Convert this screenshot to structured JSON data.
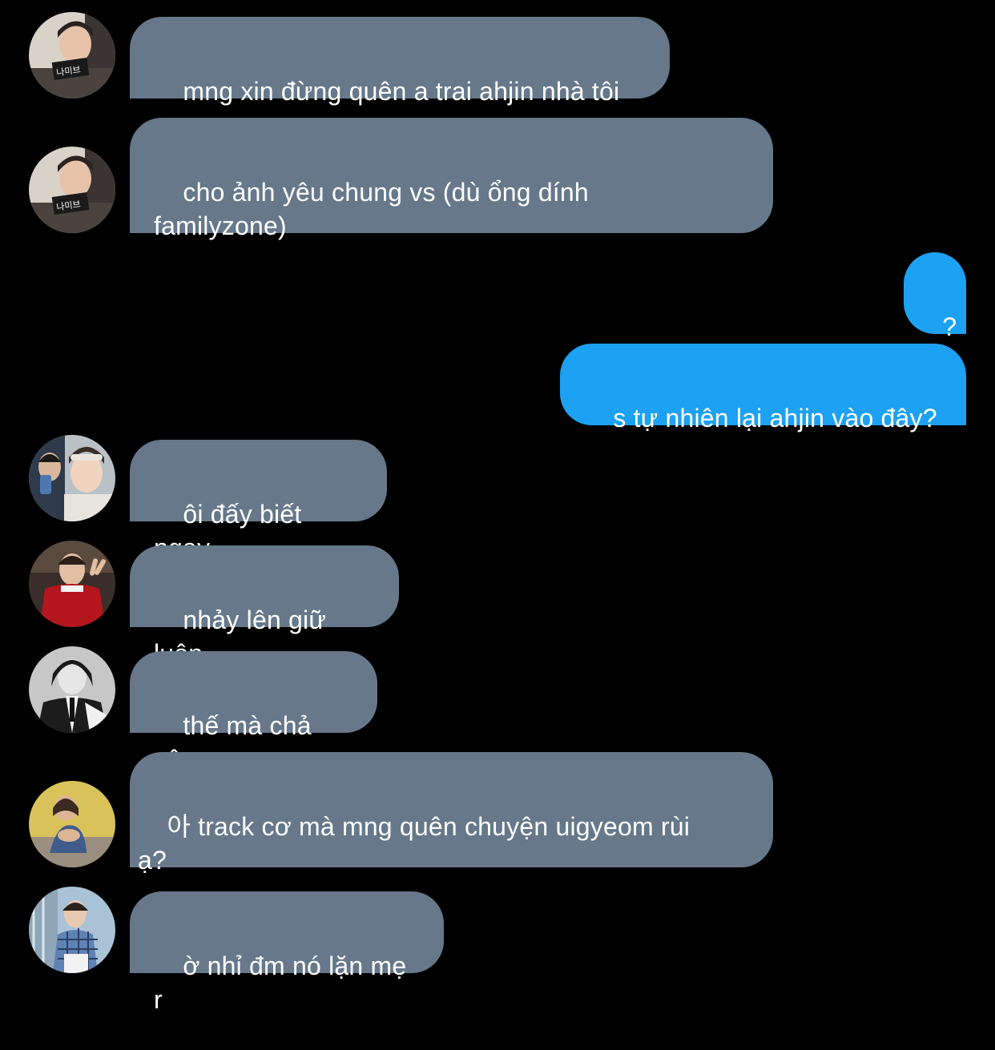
{
  "conversation": {
    "messages": [
      {
        "sender": "incoming",
        "avatar": "avatar-boy-with-sign",
        "text": "mng xin đừng quên a trai ahjin nhà tôi",
        "sign_text": "나미브"
      },
      {
        "sender": "incoming",
        "avatar": "avatar-boy-with-sign",
        "text": "cho ảnh yêu chung vs (dù ổng dính\nfamilyzone)",
        "sign_text": "나미브"
      },
      {
        "sender": "outgoing",
        "text": "?"
      },
      {
        "sender": "outgoing",
        "text": "s tự nhiên lại ahjin vào đây?"
      },
      {
        "sender": "incoming",
        "avatar": "avatar-two-people-selfie",
        "text": "ôi đấy biết ngay"
      },
      {
        "sender": "incoming",
        "avatar": "avatar-red-jacket-peace",
        "text": "nhảy lên giữ luôn"
      },
      {
        "sender": "incoming",
        "avatar": "avatar-bw-suit",
        "text": "thế mà chả yêu"
      },
      {
        "sender": "incoming",
        "avatar": "avatar-girl-yellow-bg",
        "text": "아 track cơ mà mng quên chuyện uigyeom rùi\nạ?"
      },
      {
        "sender": "incoming",
        "avatar": "avatar-boy-plaid-shirt",
        "text": "ờ nhỉ đm nó lặn mẹ r"
      }
    ]
  },
  "colors": {
    "background": "#000000",
    "incoming_bubble": "#66788a",
    "outgoing_bubble": "#1da1f2",
    "text": "#ffffff"
  }
}
